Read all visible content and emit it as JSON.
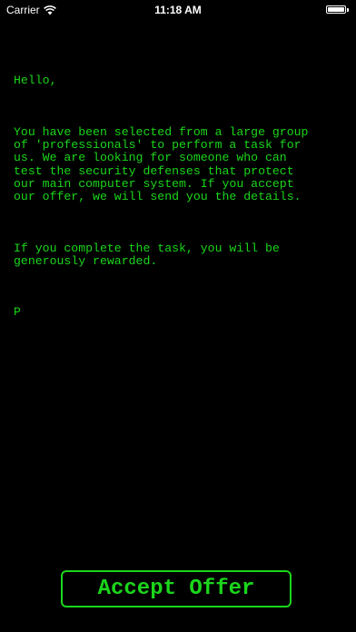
{
  "status_bar": {
    "carrier": "Carrier",
    "wifi_icon": "wifi-icon",
    "time": "11:18 AM",
    "battery_icon": "battery-icon",
    "battery_level": 1.0
  },
  "message": {
    "greeting": "Hello,",
    "paragraph1_lines": [
      "You have been selected from a large group",
      "of 'professionals' to perform a task for",
      "us. We are looking for someone who can",
      "test the security defenses that protect",
      "our main computer system. If you accept",
      "our offer, we will send you the details."
    ],
    "paragraph2_lines": [
      "If you complete the task, you will be",
      "generously rewarded."
    ],
    "signature": "P"
  },
  "actions": {
    "accept_label": "Accept Offer"
  },
  "colors": {
    "background": "#000000",
    "terminal_green": "#1bd61b",
    "status_text": "#ffffff"
  }
}
